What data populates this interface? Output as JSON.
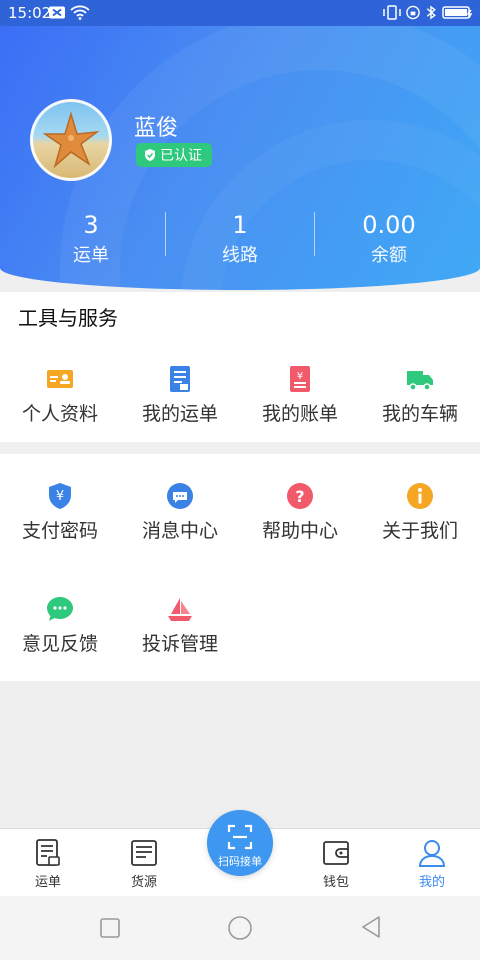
{
  "status_bar": {
    "time": "15:02"
  },
  "profile": {
    "name": "蓝俊",
    "verified_label": "已认证",
    "stats": [
      {
        "value": "3",
        "label": "运单"
      },
      {
        "value": "1",
        "label": "线路"
      },
      {
        "value": "0.00",
        "label": "余额"
      }
    ]
  },
  "tools": {
    "title": "工具与服务",
    "row1": [
      {
        "label": "个人资料",
        "icon": "id-card-icon",
        "color": "#f5a623"
      },
      {
        "label": "我的运单",
        "icon": "document-icon",
        "color": "#3b82e6"
      },
      {
        "label": "我的账单",
        "icon": "bill-icon",
        "color": "#f05a6a"
      },
      {
        "label": "我的车辆",
        "icon": "truck-icon",
        "color": "#2ec97c"
      }
    ],
    "row2": [
      {
        "label": "支付密码",
        "icon": "yuan-shield-icon",
        "color": "#3b82e6"
      },
      {
        "label": "消息中心",
        "icon": "chat-icon",
        "color": "#3b82e6"
      },
      {
        "label": "帮助中心",
        "icon": "question-icon",
        "color": "#f05a6a"
      },
      {
        "label": "关于我们",
        "icon": "info-icon",
        "color": "#f5a623"
      }
    ],
    "row3": [
      {
        "label": "意见反馈",
        "icon": "feedback-icon",
        "color": "#2ec97c"
      },
      {
        "label": "投诉管理",
        "icon": "complaint-icon",
        "color": "#f05a6a"
      }
    ]
  },
  "bottom_nav": {
    "items": [
      {
        "label": "运单",
        "icon": "waybill-icon"
      },
      {
        "label": "货源",
        "icon": "cargo-icon"
      },
      {
        "label": "钱包",
        "icon": "wallet-icon"
      },
      {
        "label": "我的",
        "icon": "person-icon",
        "active": true
      }
    ],
    "scan_label": "扫码接单",
    "active_color": "#3b8bf0"
  }
}
